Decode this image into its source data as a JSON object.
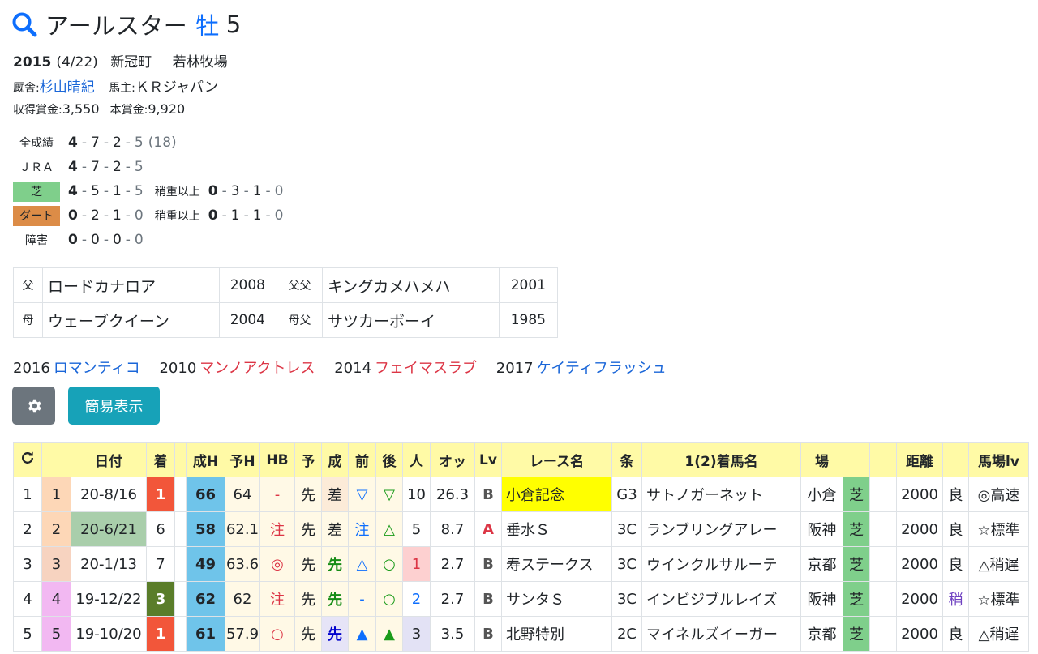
{
  "horse": {
    "name": "アールスター",
    "sex": "牡",
    "age": "5",
    "birth_year": "2015",
    "birth_date": "(4/22)",
    "region": "新冠町",
    "breeder": "若林牧場",
    "trainer_label": "厩舎:",
    "trainer": "杉山晴紀",
    "owner_label": "馬主:",
    "owner": "ＫＲジャパン",
    "earn_label": "収得賞金:",
    "earn": "3,550",
    "prize_label": "本賞金:",
    "prize": "9,920"
  },
  "records": [
    {
      "label": "全成績",
      "vals": [
        "4",
        "7",
        "2",
        "5"
      ],
      "extra": "(18)"
    },
    {
      "label": "ＪＲＡ",
      "vals": [
        "4",
        "7",
        "2",
        "5"
      ]
    },
    {
      "label": "芝",
      "vals": [
        "4",
        "5",
        "1",
        "5"
      ],
      "sub_label": "稍重以上",
      "sub_vals": [
        "0",
        "3",
        "1",
        "0"
      ]
    },
    {
      "label": "ダート",
      "vals": [
        "0",
        "2",
        "1",
        "0"
      ],
      "sub_label": "稍重以上",
      "sub_vals": [
        "0",
        "1",
        "1",
        "0"
      ]
    },
    {
      "label": "障害",
      "vals": [
        "0",
        "0",
        "0",
        "0"
      ]
    }
  ],
  "pedigree": {
    "sire_label": "父",
    "sire": "ロードカナロア",
    "sire_year": "2008",
    "sire_sire_label": "父父",
    "sire_sire": "キングカメハメハ",
    "sire_sire_year": "2001",
    "dam_label": "母",
    "dam": "ウェーブクイーン",
    "dam_year": "2004",
    "dam_sire_label": "母父",
    "dam_sire": "サツカーボーイ",
    "dam_sire_year": "1985"
  },
  "siblings": [
    {
      "year": "2016",
      "name": "ロマンティコ",
      "color": "blue"
    },
    {
      "year": "2010",
      "name": "マンノアクトレス",
      "color": "red"
    },
    {
      "year": "2014",
      "name": "フェイマスラブ",
      "color": "red"
    },
    {
      "year": "2017",
      "name": "ケイティフラッシュ",
      "color": "blue"
    }
  ],
  "buttons": {
    "simple_view": "簡易表示"
  },
  "table": {
    "headers": [
      "",
      "",
      "日付",
      "着",
      "",
      "成H",
      "予H",
      "HB",
      "予",
      "成",
      "前",
      "後",
      "人",
      "オッ",
      "Lv",
      "レース名",
      "条",
      "1(2)着馬名",
      "場",
      "",
      "",
      "距離",
      "",
      "馬場lv"
    ],
    "rows": [
      {
        "no": "1",
        "gate": "1",
        "date": "20-8/16",
        "res": "1",
        "sh": "66",
        "yh": "64",
        "hb": "-",
        "yo": "先",
        "sei": "差",
        "mae": "▽",
        "ato": "▽",
        "pop": "10",
        "odds": "26.3",
        "lv": "B",
        "race": "小倉記念",
        "cls": "G3",
        "horse": "サトノガーネット",
        "course": "小倉",
        "surf": "芝",
        "dist": "2000",
        "cond": "良",
        "blv": "◎高速"
      },
      {
        "no": "2",
        "gate": "2",
        "date": "20-6/21",
        "res": "6",
        "sh": "58",
        "yh": "62.1",
        "hb": "注",
        "yo": "先",
        "sei": "差",
        "mae": "注",
        "ato": "△",
        "pop": "5",
        "odds": "8.7",
        "lv": "A",
        "race": "垂水Ｓ",
        "cls": "3C",
        "horse": "ランブリングアレー",
        "course": "阪神",
        "surf": "芝",
        "dist": "2000",
        "cond": "良",
        "blv": "☆標準"
      },
      {
        "no": "3",
        "gate": "3",
        "date": "20-1/13",
        "res": "7",
        "sh": "49",
        "yh": "63.6",
        "hb": "◎",
        "yo": "先",
        "sei": "先",
        "mae": "△",
        "ato": "○",
        "pop": "1",
        "odds": "2.7",
        "lv": "B",
        "race": "寿ステークス",
        "cls": "3C",
        "horse": "ウインクルサルーテ",
        "course": "京都",
        "surf": "芝",
        "dist": "2000",
        "cond": "良",
        "blv": "△稍遅"
      },
      {
        "no": "4",
        "gate": "4",
        "date": "19-12/22",
        "res": "3",
        "sh": "62",
        "yh": "62",
        "hb": "注",
        "yo": "先",
        "sei": "先",
        "mae": "-",
        "ato": "○",
        "pop": "2",
        "odds": "2.7",
        "lv": "B",
        "race": "サンタＳ",
        "cls": "3C",
        "horse": "インビジブルレイズ",
        "course": "阪神",
        "surf": "芝",
        "dist": "2000",
        "cond": "稍",
        "blv": "☆標準"
      },
      {
        "no": "5",
        "gate": "5",
        "date": "19-10/20",
        "res": "1",
        "sh": "61",
        "yh": "57.9",
        "hb": "○",
        "yo": "先",
        "sei": "先",
        "mae": "▲",
        "ato": "▲",
        "pop": "3",
        "odds": "3.5",
        "lv": "B",
        "race": "北野特別",
        "cls": "2C",
        "horse": "マイネルズイーガー",
        "course": "京都",
        "surf": "芝",
        "dist": "2000",
        "cond": "良",
        "blv": "△稍遅"
      }
    ]
  }
}
